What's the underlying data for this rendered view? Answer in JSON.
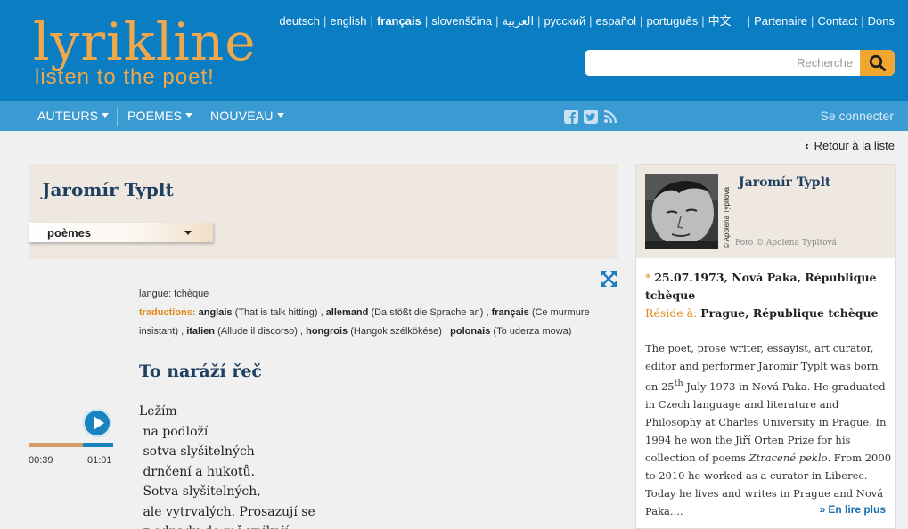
{
  "header": {
    "logo_word": "lyrikline",
    "logo_tagline": "listen to the poet!",
    "languages": [
      {
        "label": "deutsch",
        "active": false
      },
      {
        "label": "english",
        "active": false
      },
      {
        "label": "français",
        "active": true
      },
      {
        "label": "slovenščina",
        "active": false
      },
      {
        "label": "العربية",
        "active": false
      },
      {
        "label": "русский",
        "active": false
      },
      {
        "label": "español",
        "active": false
      },
      {
        "label": "português",
        "active": false
      },
      {
        "label": "中文",
        "active": false
      }
    ],
    "links": [
      "Partenaire",
      "Contact",
      "Dons"
    ],
    "search": {
      "placeholder": "Recherche",
      "value": ""
    },
    "brand_color": "#0a7dc3",
    "accent_color": "#f0a84a"
  },
  "nav": {
    "items": [
      {
        "label": "AUTEURS"
      },
      {
        "label": "POÈMES"
      },
      {
        "label": "NOUVEAU"
      }
    ],
    "social_icons": [
      "facebook-icon",
      "twitter-icon",
      "rss-icon"
    ],
    "login_label": "Se connecter",
    "nav_color": "#3a9ad2"
  },
  "back_link": "Retour à la liste",
  "main": {
    "poet_name": "Jaromír Typlt",
    "poems_dropdown": "poèmes",
    "language_label": "langue:",
    "language_value": "tchèque",
    "translations_label": "traductions:",
    "translations": [
      {
        "lang": "anglais",
        "title": "(That is talk hitting)"
      },
      {
        "lang": "allemand",
        "title": "(Da stößt die Sprache an)"
      },
      {
        "lang": "français",
        "title": "(Ce murmure insistant)"
      },
      {
        "lang": "italien",
        "title": "(Alludе il discorso)"
      },
      {
        "lang": "hongrois",
        "title": "(Hangok szélkökése)"
      },
      {
        "lang": "polonais",
        "title": "(To uderza mowa)"
      }
    ],
    "poem_title": "To naráží řeč",
    "poem_lines": [
      "Ležím",
      " na podloží",
      " sotva slyšitelných",
      " drnčení a hukotů.",
      " Sotva slyšitelných,",
      " ale vytrvalých. Prosazují se",
      " z odpadu do mě vnikají"
    ]
  },
  "player": {
    "current_time": "00:39",
    "total_time": "01:01",
    "progress": 0.639
  },
  "sidebar": {
    "name": "Jaromír Typlt",
    "photo_credit_vertical": "© Apolena Typltová",
    "photo_credit": "Foto © Apolena Typltová",
    "birth_marker": "*",
    "birth": "25.07.1973, Nová Paka, République tchèque",
    "resides_label": "Réside à:",
    "resides": "Prague, République tchèque",
    "bio_html_parts": {
      "p1": "The poet, prose writer, essayist, art curator, editor and performer Jaromír Typlt was born on 25",
      "sup": "th",
      "p2": " July 1973 in Nová Paka. He graduated in Czech language and literature and Philosophy at Charles University in Prague. In 1994 he won the Jiří Orten Prize for his collection of poems ",
      "em": "Ztracené peklo",
      "p3": ". From 2000 to 2010 he worked as a curator in Liberec. Today he lives and writes in Prague and Nová Paka...."
    },
    "read_more": "En lire plus"
  }
}
